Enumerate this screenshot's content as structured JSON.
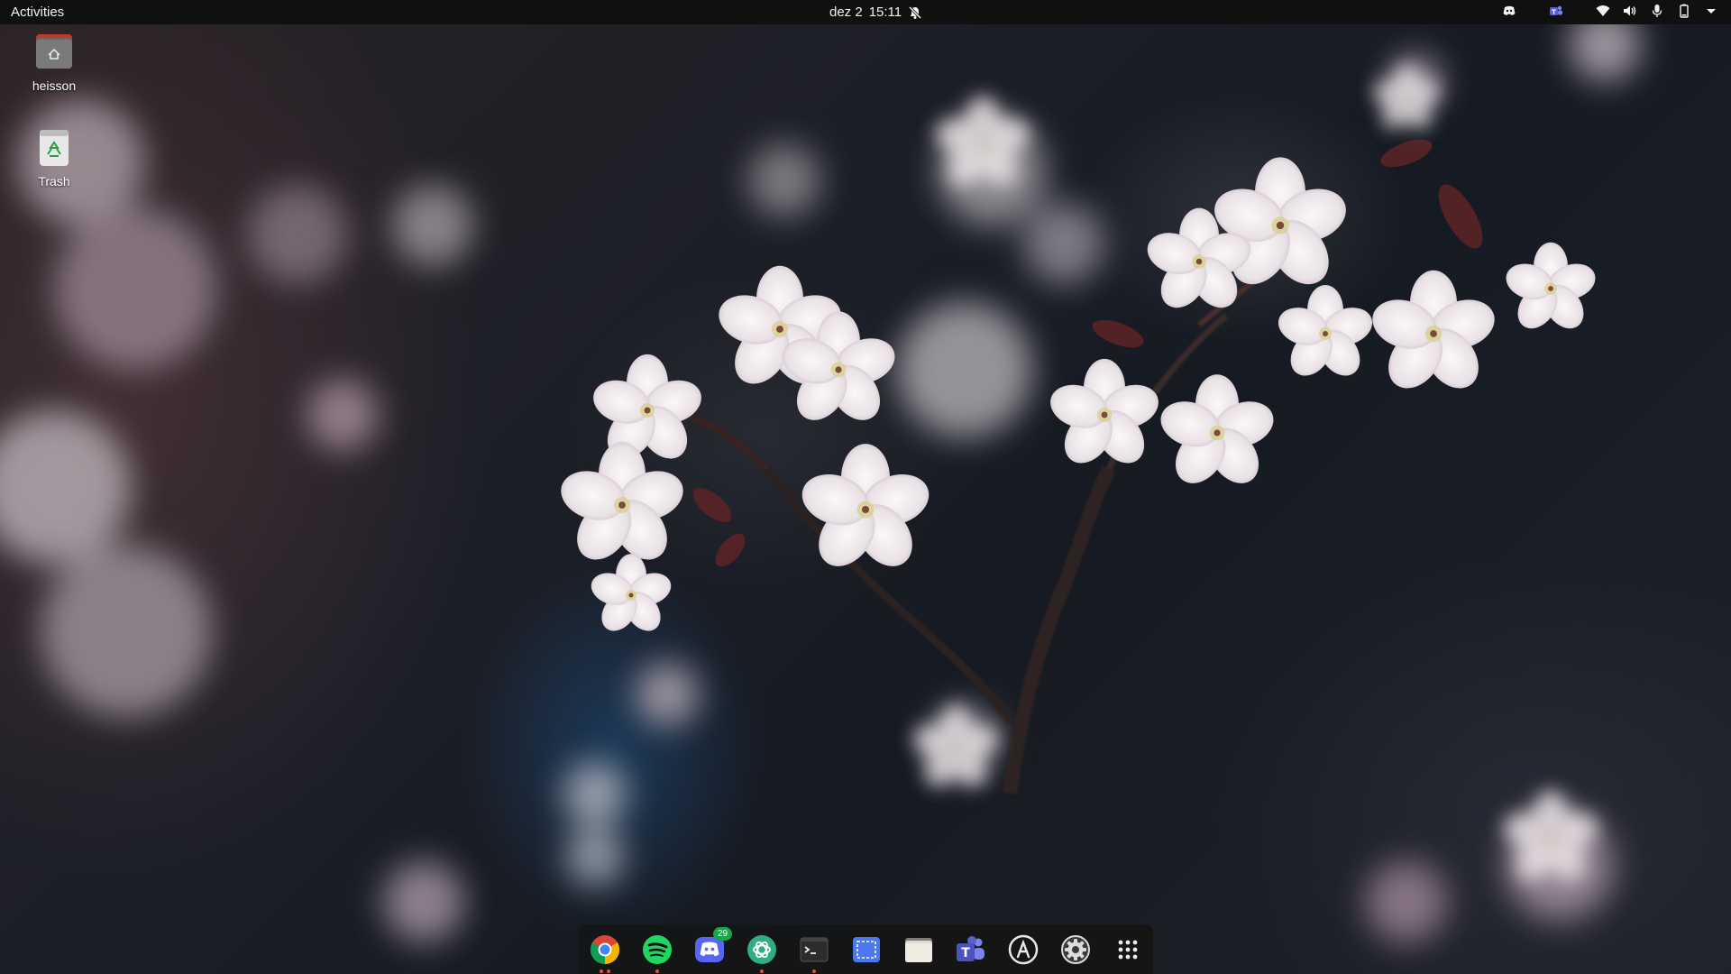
{
  "topbar": {
    "activities_label": "Activities",
    "date": "dez 2",
    "time": "15:11",
    "icons": [
      "notifications-off-icon",
      "discord-tray-icon",
      "teams-tray-icon",
      "wifi-icon",
      "volume-icon",
      "microphone-icon",
      "battery-icon",
      "system-menu-chevron-icon"
    ]
  },
  "desktop": {
    "icons": [
      {
        "label": "heisson",
        "icon": "home-folder-icon"
      },
      {
        "label": "Trash",
        "icon": "trash-icon"
      }
    ]
  },
  "dock": {
    "apps": [
      {
        "name": "Google Chrome",
        "icon": "chrome-icon",
        "running": true,
        "windows": 2
      },
      {
        "name": "Spotify",
        "icon": "spotify-icon",
        "running": true,
        "windows": 1
      },
      {
        "name": "Discord",
        "icon": "discord-icon",
        "running": false,
        "badge": "29"
      },
      {
        "name": "ChatGPT",
        "icon": "chatgpt-icon",
        "running": true,
        "windows": 1
      },
      {
        "name": "Terminal",
        "icon": "terminal-icon",
        "running": true,
        "windows": 1
      },
      {
        "name": "Screenshot",
        "icon": "screenshot-icon",
        "running": false
      },
      {
        "name": "Files",
        "icon": "files-icon",
        "running": false
      },
      {
        "name": "Microsoft Teams",
        "icon": "teams-icon",
        "running": false
      },
      {
        "name": "Software",
        "icon": "software-store-icon",
        "running": false
      },
      {
        "name": "Settings",
        "icon": "settings-icon",
        "running": false
      },
      {
        "name": "Show Applications",
        "icon": "app-grid-icon",
        "running": false
      }
    ]
  },
  "colors": {
    "topbar_bg": "#101010",
    "running_dot": "#e8532c",
    "badge_bg": "#19a64a"
  }
}
